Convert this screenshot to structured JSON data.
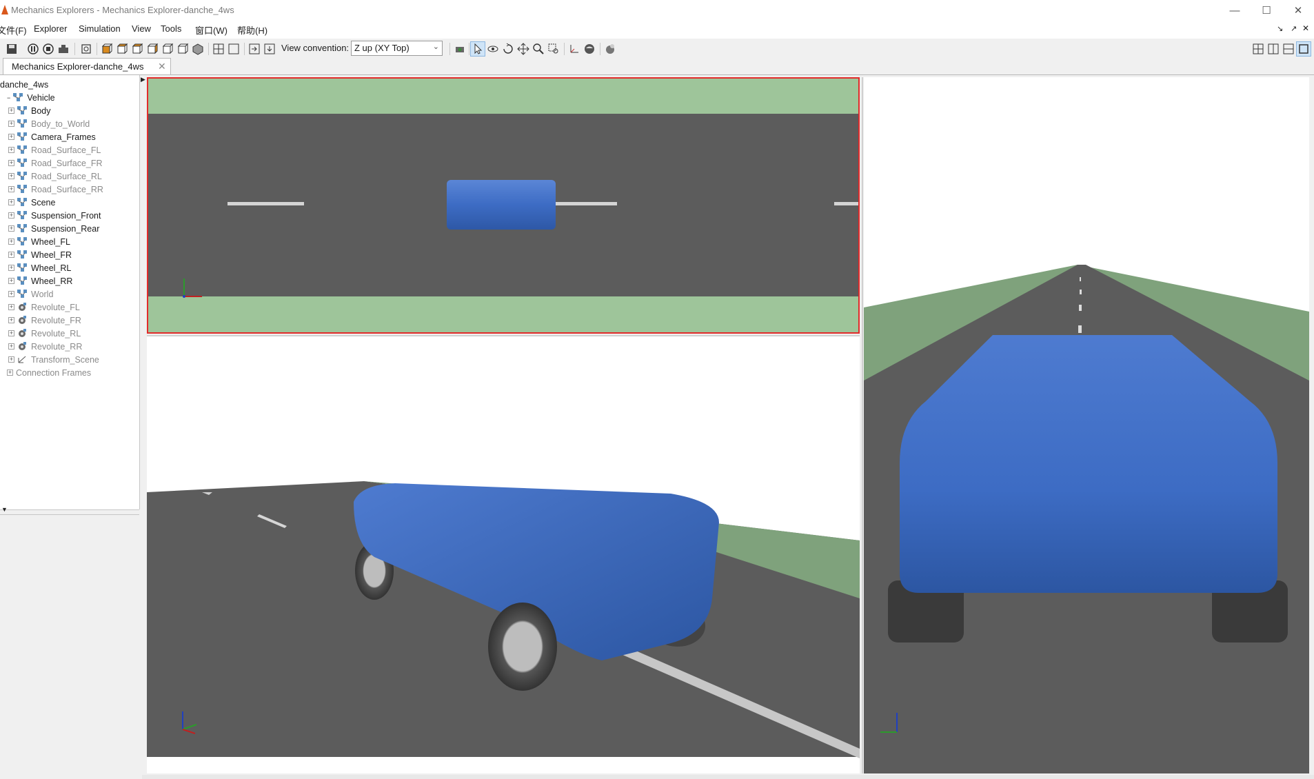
{
  "window": {
    "title": "Mechanics Explorers - Mechanics Explorer-danche_4ws",
    "controls": [
      "—",
      "☐",
      "✕"
    ]
  },
  "menu": [
    "文件(F)",
    "Explorer",
    "Simulation",
    "View",
    "Tools",
    "窗口(W)",
    "帮助(H)"
  ],
  "toolbar": {
    "view_convention_label": "View convention:",
    "view_convention_value": "Z up (XY Top)"
  },
  "tab": {
    "label": "Mechanics Explorer-danche_4ws",
    "close": "✕"
  },
  "tree": {
    "root": "danche_4ws",
    "vehicle": "Vehicle",
    "frames": [
      {
        "label": "Body",
        "dim": false
      },
      {
        "label": "Body_to_World",
        "dim": true
      },
      {
        "label": "Camera_Frames",
        "dim": false
      },
      {
        "label": "Road_Surface_FL",
        "dim": true
      },
      {
        "label": "Road_Surface_FR",
        "dim": true
      },
      {
        "label": "Road_Surface_RL",
        "dim": true
      },
      {
        "label": "Road_Surface_RR",
        "dim": true
      },
      {
        "label": "Scene",
        "dim": false
      },
      {
        "label": "Suspension_Front",
        "dim": false
      },
      {
        "label": "Suspension_Rear",
        "dim": false
      },
      {
        "label": "Wheel_FL",
        "dim": false
      },
      {
        "label": "Wheel_FR",
        "dim": false
      },
      {
        "label": "Wheel_RL",
        "dim": false
      },
      {
        "label": "Wheel_RR",
        "dim": false
      },
      {
        "label": "World",
        "dim": true
      }
    ],
    "joints": [
      {
        "label": "Revolute_FL",
        "dim": true
      },
      {
        "label": "Revolute_FR",
        "dim": true
      },
      {
        "label": "Revolute_RL",
        "dim": true
      },
      {
        "label": "Revolute_RR",
        "dim": true
      },
      {
        "label": "Transform_Scene",
        "dim": true
      }
    ],
    "connection_frames": "Connection Frames"
  },
  "colors": {
    "grass": "#9ec59a",
    "road": "#5c5c5c",
    "body": "#3d6cc4",
    "selected_view_border": "#e32b2b",
    "grass_persp": "#7fa27c"
  }
}
